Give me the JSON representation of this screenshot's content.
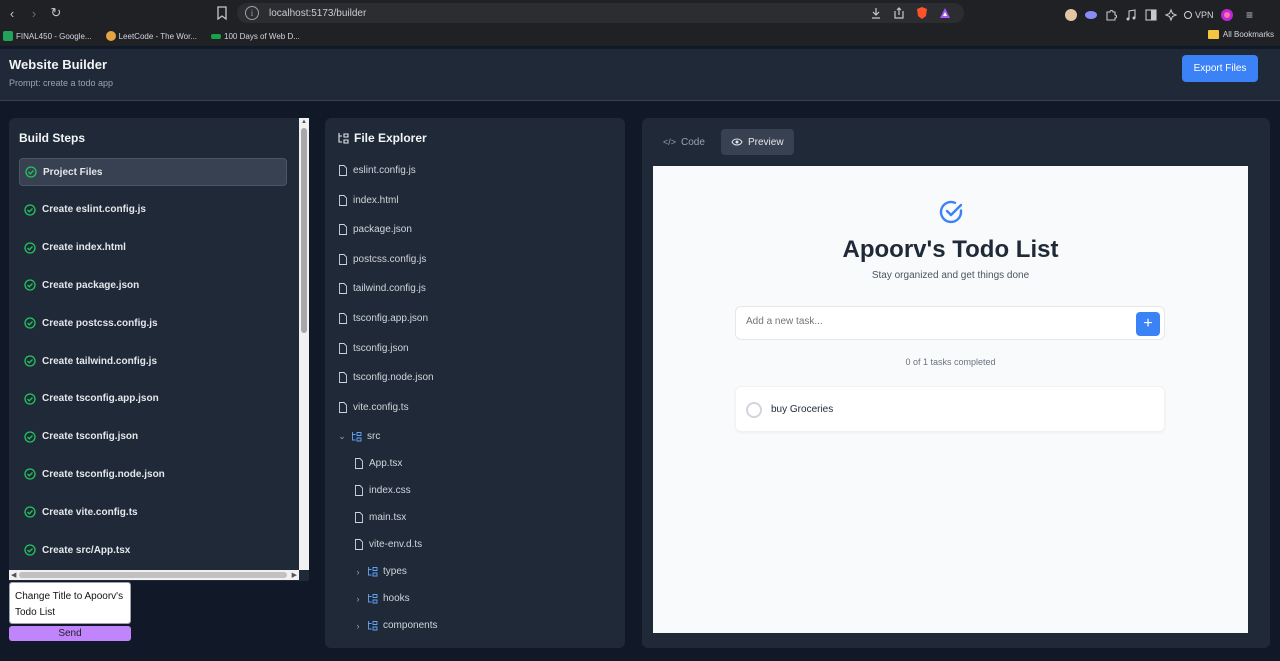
{
  "browser": {
    "url": "localhost:5173/builder",
    "bookmarks": [
      "FINAL450 - Google...",
      "LeetCode - The Wor...",
      "100 Days of Web D..."
    ],
    "all_bookmarks": "All Bookmarks",
    "vpn": "VPN"
  },
  "header": {
    "title": "Website Builder",
    "prompt": "Prompt: create a todo app",
    "export_label": "Export Files"
  },
  "steps": {
    "title": "Build Steps",
    "items": [
      "Project Files",
      "Create eslint.config.js",
      "Create index.html",
      "Create package.json",
      "Create postcss.config.js",
      "Create tailwind.config.js",
      "Create tsconfig.app.json",
      "Create tsconfig.json",
      "Create tsconfig.node.json",
      "Create vite.config.ts",
      "Create src/App.tsx"
    ]
  },
  "chat": {
    "input_value": "Change Title to Apoorv's Todo List",
    "send_label": "Send"
  },
  "explorer": {
    "title": "File Explorer",
    "root_files": [
      "eslint.config.js",
      "index.html",
      "package.json",
      "postcss.config.js",
      "tailwind.config.js",
      "tsconfig.app.json",
      "tsconfig.json",
      "tsconfig.node.json",
      "vite.config.ts"
    ],
    "src_folder": "src",
    "src_files": [
      "App.tsx",
      "index.css",
      "main.tsx",
      "vite-env.d.ts"
    ],
    "sub_folders": [
      "types",
      "hooks",
      "components"
    ]
  },
  "preview": {
    "tab_code": "Code",
    "tab_preview": "Preview",
    "active_tab": "Preview",
    "todo_title": "Apoorv's Todo List",
    "todo_subtitle": "Stay organized and get things done",
    "input_placeholder": "Add a new task...",
    "count_text": "0 of 1 tasks completed",
    "tasks": [
      "buy Groceries"
    ]
  },
  "colors": {
    "accent": "#3b82f6",
    "send": "#c084fc",
    "check": "#22c55e"
  }
}
